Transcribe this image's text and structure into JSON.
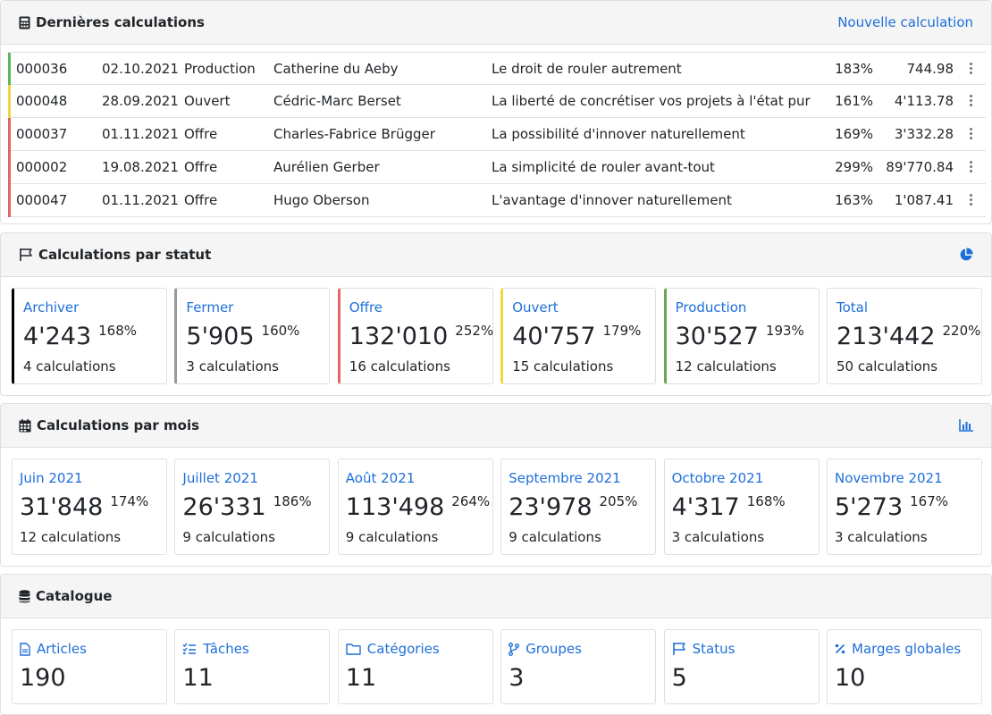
{
  "latest": {
    "title": "Dernières calculations",
    "new_link": "Nouvelle calculation",
    "rows": [
      {
        "num": "000036",
        "date": "02.10.2021",
        "state": "Production",
        "customer": "Catherine du Aeby",
        "description": "Le droit de rouler autrement",
        "margin": "183%",
        "total": "744.98",
        "color": "#5cb85c"
      },
      {
        "num": "000048",
        "date": "28.09.2021",
        "state": "Ouvert",
        "customer": "Cédric-Marc Berset",
        "description": "La liberté de concrétiser vos projets à l'état pur",
        "margin": "161%",
        "total": "4'113.78",
        "color": "#f0d640"
      },
      {
        "num": "000037",
        "date": "01.11.2021",
        "state": "Offre",
        "customer": "Charles-Fabrice Brügger",
        "description": "La possibilité d'innover naturellement",
        "margin": "169%",
        "total": "3'332.28",
        "color": "#e06666"
      },
      {
        "num": "000002",
        "date": "19.08.2021",
        "state": "Offre",
        "customer": "Aurélien Gerber",
        "description": "La simplicité de rouler avant-tout",
        "margin": "299%",
        "total": "89'770.84",
        "color": "#e06666"
      },
      {
        "num": "000047",
        "date": "01.11.2021",
        "state": "Offre",
        "customer": "Hugo Oberson",
        "description": "L'avantage d'innover naturellement",
        "margin": "163%",
        "total": "1'087.41",
        "color": "#e06666"
      }
    ]
  },
  "by_state": {
    "title": "Calculations par statut",
    "items": [
      {
        "label": "Archiver",
        "value": "4'243",
        "pct": "168%",
        "count": "4 calculations",
        "color": "#000000"
      },
      {
        "label": "Fermer",
        "value": "5'905",
        "pct": "160%",
        "count": "3 calculations",
        "color": "#999999"
      },
      {
        "label": "Offre",
        "value": "132'010",
        "pct": "252%",
        "count": "16 calculations",
        "color": "#e06666"
      },
      {
        "label": "Ouvert",
        "value": "40'757",
        "pct": "179%",
        "count": "15 calculations",
        "color": "#f0d640"
      },
      {
        "label": "Production",
        "value": "30'527",
        "pct": "193%",
        "count": "12 calculations",
        "color": "#6aa84f"
      },
      {
        "label": "Total",
        "value": "213'442",
        "pct": "220%",
        "count": "50 calculations",
        "color": "#dfdfdf"
      }
    ]
  },
  "by_month": {
    "title": "Calculations par mois",
    "items": [
      {
        "label": "Juin 2021",
        "value": "31'848",
        "pct": "174%",
        "count": "12 calculations"
      },
      {
        "label": "Juillet 2021",
        "value": "26'331",
        "pct": "186%",
        "count": "9 calculations"
      },
      {
        "label": "Août 2021",
        "value": "113'498",
        "pct": "264%",
        "count": "9 calculations"
      },
      {
        "label": "Septembre 2021",
        "value": "23'978",
        "pct": "205%",
        "count": "9 calculations"
      },
      {
        "label": "Octobre 2021",
        "value": "4'317",
        "pct": "168%",
        "count": "3 calculations"
      },
      {
        "label": "Novembre 2021",
        "value": "5'273",
        "pct": "167%",
        "count": "3 calculations"
      }
    ]
  },
  "catalog": {
    "title": "Catalogue",
    "items": [
      {
        "label": "Articles",
        "value": "190",
        "icon": "file-icon"
      },
      {
        "label": "Tâches",
        "value": "11",
        "icon": "tasks-icon"
      },
      {
        "label": "Catégories",
        "value": "11",
        "icon": "folder-icon"
      },
      {
        "label": "Groupes",
        "value": "3",
        "icon": "code-branch-icon"
      },
      {
        "label": "Status",
        "value": "5",
        "icon": "flag-icon"
      },
      {
        "label": "Marges globales",
        "value": "10",
        "icon": "percent-icon"
      }
    ]
  },
  "colors": {
    "accent": "#1e6fd9"
  }
}
